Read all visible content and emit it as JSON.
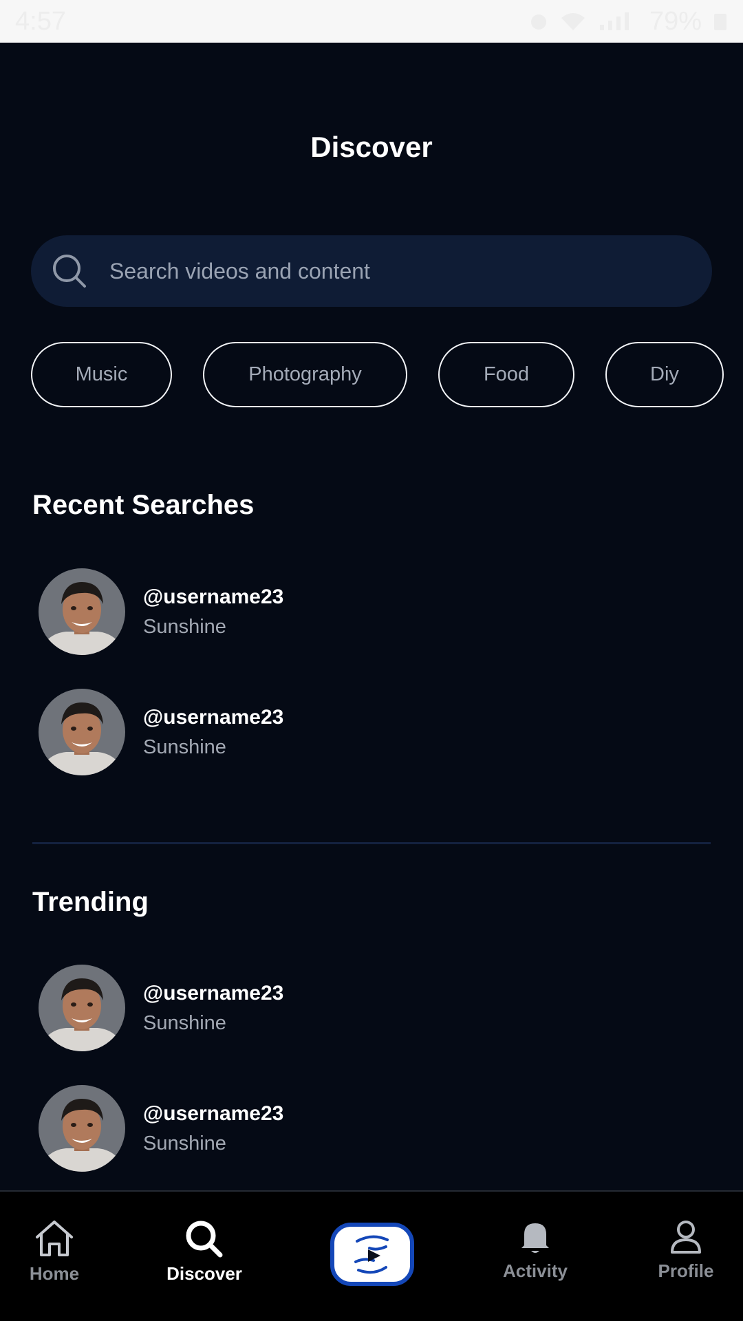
{
  "status_bar": {
    "time": "4:57",
    "battery": "79%"
  },
  "header": {
    "title": "Discover"
  },
  "search": {
    "placeholder": "Search videos and content",
    "icon": "search-icon"
  },
  "categories": [
    "Music",
    "Photography",
    "Food",
    "Diy"
  ],
  "recent_searches": {
    "title": "Recent Searches",
    "items": [
      {
        "username": "@username23",
        "subtitle": "Sunshine"
      },
      {
        "username": "@username23",
        "subtitle": "Sunshine"
      }
    ]
  },
  "trending": {
    "title": "Trending",
    "items": [
      {
        "username": "@username23",
        "subtitle": "Sunshine"
      },
      {
        "username": "@username23",
        "subtitle": "Sunshine"
      }
    ]
  },
  "bottom_nav": {
    "items": [
      {
        "label": "Home",
        "icon": "home-icon"
      },
      {
        "label": "Discover",
        "icon": "search-icon",
        "active": true
      },
      {
        "label": "",
        "icon": "create-video-icon"
      },
      {
        "label": "Activity",
        "icon": "bell-icon"
      },
      {
        "label": "Profile",
        "icon": "person-icon"
      }
    ]
  },
  "colors": {
    "background": "#050a15",
    "search_background": "#0f1c35",
    "accent": "#1447b8",
    "muted_text": "#a3a9b4"
  }
}
